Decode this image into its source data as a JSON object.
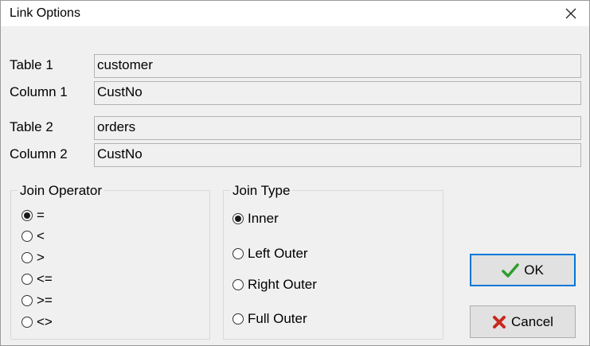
{
  "window": {
    "title": "Link Options",
    "close_icon": "close-icon"
  },
  "fields": {
    "table1": {
      "label": "Table 1",
      "value": "customer"
    },
    "column1": {
      "label": "Column 1",
      "value": "CustNo"
    },
    "table2": {
      "label": "Table 2",
      "value": "orders"
    },
    "column2": {
      "label": "Column 2",
      "value": "CustNo"
    }
  },
  "join_operator": {
    "legend": "Join Operator",
    "options": [
      "=",
      "<",
      ">",
      "<=",
      ">=",
      "<>"
    ],
    "selected": "="
  },
  "join_type": {
    "legend": "Join Type",
    "options": [
      "Inner",
      "Left Outer",
      "Right Outer",
      "Full Outer"
    ],
    "selected": "Inner"
  },
  "buttons": {
    "ok": {
      "label": "OK",
      "icon": "check-icon",
      "color": "#2e9e2e"
    },
    "cancel": {
      "label": "Cancel",
      "icon": "x-icon",
      "color": "#c8281e"
    }
  }
}
